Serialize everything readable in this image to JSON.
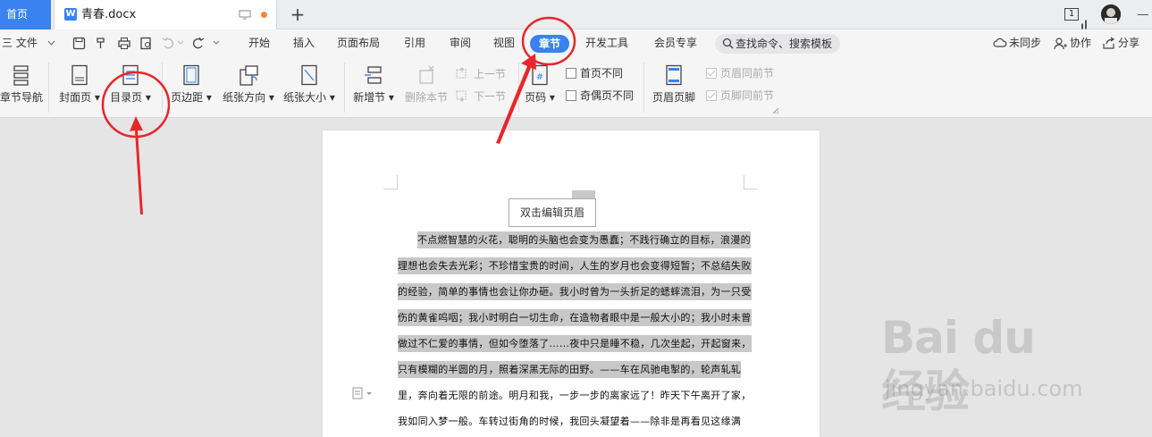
{
  "tabbar": {
    "home": "首页",
    "document": "青春.docx",
    "page_count_badge": "1"
  },
  "menubar": {
    "file": "三 文件",
    "items": [
      "开始",
      "插入",
      "页面布局",
      "引用",
      "审阅",
      "视图",
      "开发工具",
      "会员专享"
    ],
    "active_tab": "章节",
    "search_placeholder": "查找命令、搜索模板",
    "sync": "未同步",
    "collab": "协作",
    "share": "分享"
  },
  "ribbon": {
    "chapter_nav": "章节导航",
    "cover_page": "封面页",
    "toc_page": "目录页",
    "margins": "页边距",
    "orientation": "纸张方向",
    "size": "纸张大小",
    "new_section": "新增节",
    "delete_section": "删除本节",
    "prev_section": "上一节",
    "next_section": "下一节",
    "page_number": "页码",
    "first_page_diff": "首页不同",
    "odd_even_diff": "奇偶页不同",
    "header_footer": "页眉页脚",
    "header_same_prev": "页眉同前节",
    "footer_same_prev": "页脚同前节"
  },
  "document": {
    "header_hint": "双击编辑页眉",
    "lines": [
      "不点燃智慧的火花，聪明的头脑也会变为愚蠢；不践行确立的目标，浪漫的",
      "理想也会失去光彩；不珍惜宝贵的时间，人生的岁月也会变得短暂；不总结失败",
      "的经验，简单的事情也会让你办砸。我小时曾为一头折足的蟋蟀流泪，为一只受",
      "伤的黄雀呜咽；我小时明白一切生命，在造物者眼中是一般大小的；我小时未曾",
      "做过不仁爱的事情，但如今堕落了......夜中只是睡不稳，几次坐起，开起窗来，",
      "只有模糊的半圆的月，照着深黑无际的田野。——车在风驰电掣的，轮声轧轧",
      "里，奔向着无限的前途。明月和我，一步一步的离家远了！昨天下午离开了家，",
      "我如同入梦一般。车转过街角的时候，我回头凝望着——除非是再看见这缘满"
    ]
  },
  "watermark": {
    "logo": "Bai du 经验",
    "url": "jingyan.baidu.com"
  },
  "colors": {
    "accent": "#3a82ef",
    "annotation": "#e8262b",
    "highlight": "#c8c8c8"
  }
}
